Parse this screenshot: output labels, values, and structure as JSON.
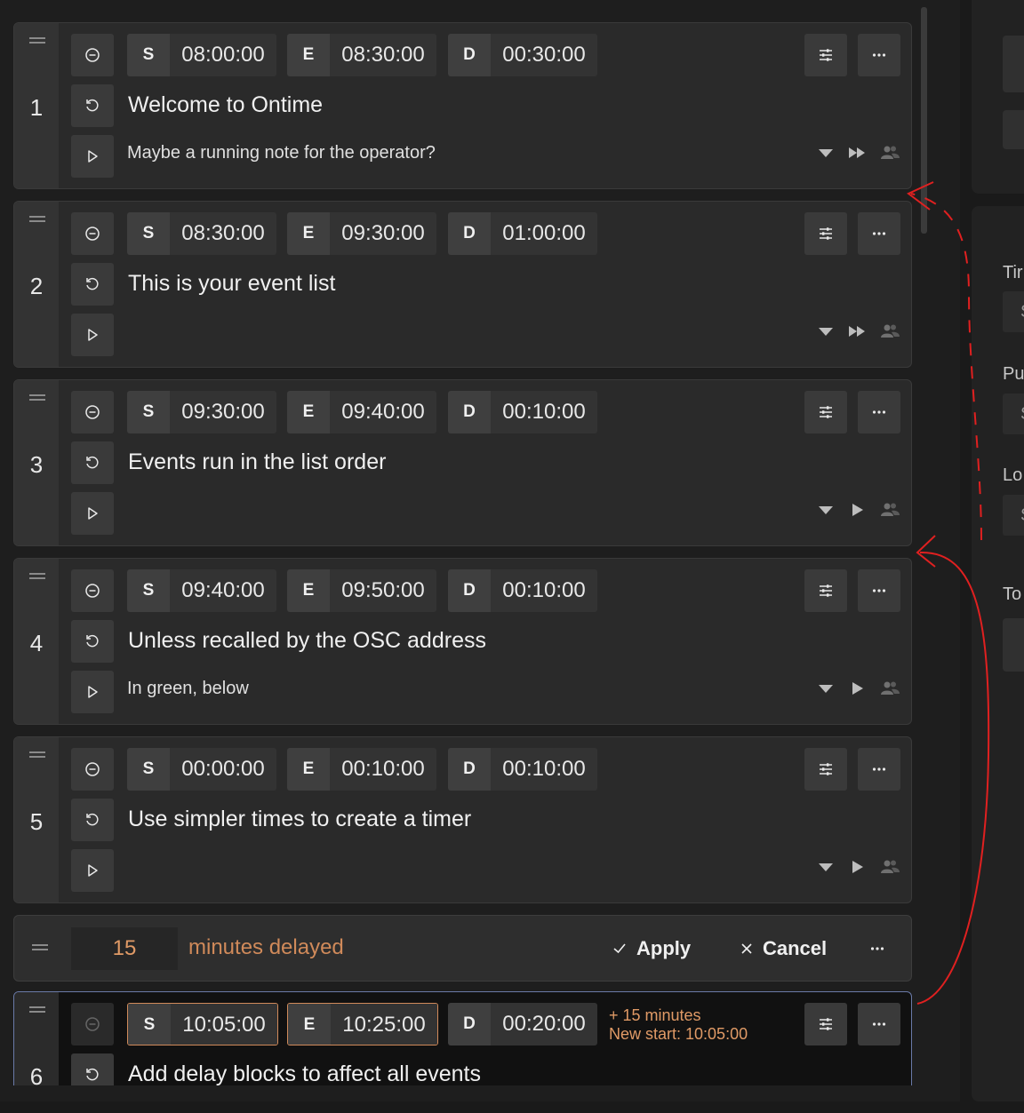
{
  "labels": {
    "start": "S",
    "end": "E",
    "duration": "D"
  },
  "events": [
    {
      "number": "1",
      "start": "08:00:00",
      "end": "08:30:00",
      "duration": "00:30:00",
      "title": "Welcome to Ontime",
      "note": "Maybe a running note for the operator?",
      "end_action_icon": "skip-forward-icon"
    },
    {
      "number": "2",
      "start": "08:30:00",
      "end": "09:30:00",
      "duration": "01:00:00",
      "title": "This is your event list",
      "note": "",
      "end_action_icon": "skip-forward-icon"
    },
    {
      "number": "3",
      "start": "09:30:00",
      "end": "09:40:00",
      "duration": "00:10:00",
      "title": "Events run in the list order",
      "note": "",
      "end_action_icon": "play-icon"
    },
    {
      "number": "4",
      "start": "09:40:00",
      "end": "09:50:00",
      "duration": "00:10:00",
      "title": "Unless recalled by the OSC address",
      "note": "In green, below",
      "end_action_icon": "play-icon"
    },
    {
      "number": "5",
      "start": "00:00:00",
      "end": "00:10:00",
      "duration": "00:10:00",
      "title": "Use simpler times to create a timer",
      "note": "",
      "end_action_icon": "play-icon"
    }
  ],
  "delay_block": {
    "value": "15",
    "label": "minutes delayed",
    "apply_label": "Apply",
    "cancel_label": "Cancel"
  },
  "selected_event": {
    "number": "6",
    "start": "10:05:00",
    "end": "10:25:00",
    "duration": "00:20:00",
    "title": "Add delay blocks to affect all events",
    "delay_line1": "+ 15 minutes",
    "delay_line2": "New start: 10:05:00"
  },
  "right_panel": {
    "labels": [
      "Tir",
      "Pu",
      "Lo",
      "To"
    ],
    "input_glyph": "S"
  },
  "colors": {
    "accent_delay": "#d08a5a",
    "annotation": "#e02020",
    "selected_border": "#6a7aa8",
    "background": "#1e1e1e"
  }
}
